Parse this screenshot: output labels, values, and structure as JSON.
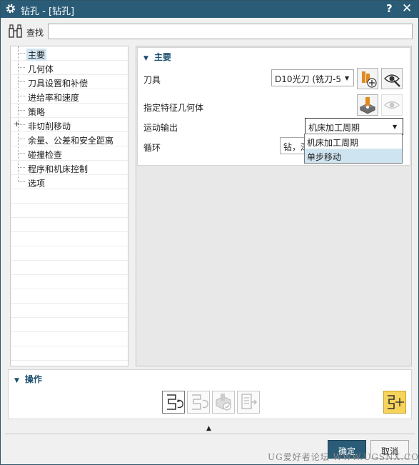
{
  "window": {
    "title": "钻孔 - [钻孔]",
    "help": "?",
    "close": "✕"
  },
  "search": {
    "label": "查找",
    "value": ""
  },
  "tree": {
    "items": [
      {
        "label": "主要",
        "selected": true,
        "expandable": false
      },
      {
        "label": "几何体",
        "selected": false,
        "expandable": false
      },
      {
        "label": "刀具设置和补偿",
        "selected": false,
        "expandable": false
      },
      {
        "label": "进给率和速度",
        "selected": false,
        "expandable": false
      },
      {
        "label": "策略",
        "selected": false,
        "expandable": false
      },
      {
        "label": "非切削移动",
        "selected": false,
        "expandable": true
      },
      {
        "label": "余量、公差和安全距离",
        "selected": false,
        "expandable": false
      },
      {
        "label": "碰撞检查",
        "selected": false,
        "expandable": false
      },
      {
        "label": "程序和机床控制",
        "selected": false,
        "expandable": false
      },
      {
        "label": "选项",
        "selected": false,
        "expandable": false
      }
    ]
  },
  "main_group": {
    "header": "主要",
    "tool_label": "刀具",
    "tool_value": "D10光刀 (铣刀-5",
    "feature_label": "指定特征几何体",
    "motion_label": "运动输出",
    "motion_value": "机床加工周期",
    "motion_options": [
      "机床加工周期",
      "单步移动"
    ],
    "motion_highlighted": 1,
    "cycle_label": "循环",
    "cycle_value": "钻，深"
  },
  "operations": {
    "header": "操作"
  },
  "buttons": {
    "ok": "确定",
    "cancel": "取消"
  },
  "watermark": "UG爱好者论坛 WWW.UGSNX.COM",
  "colors": {
    "titlebar": "#2b5c77",
    "selection": "#cfe4f1",
    "generate": "#f6d35a",
    "header_text": "#1c4f6e"
  }
}
